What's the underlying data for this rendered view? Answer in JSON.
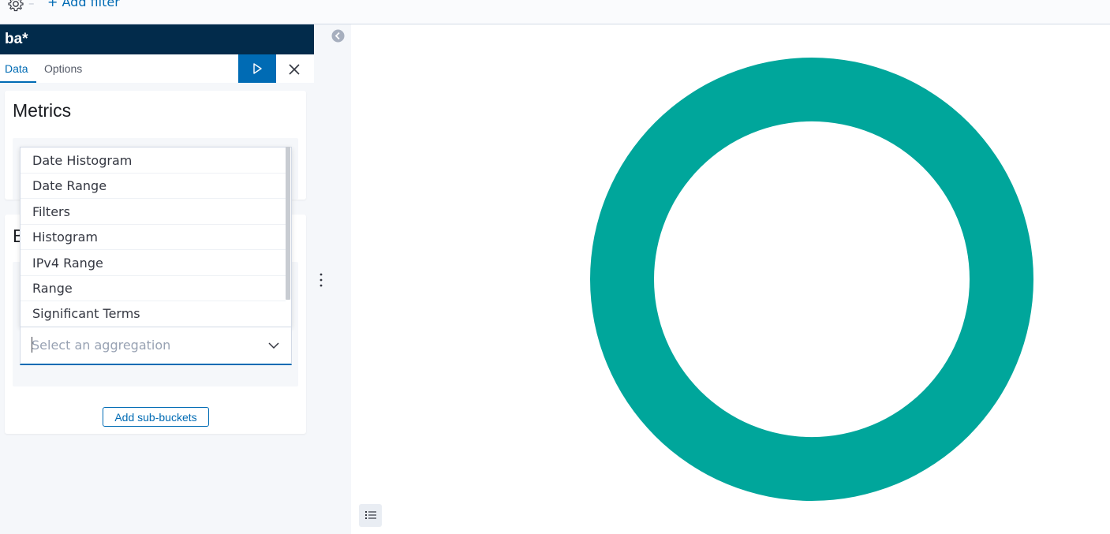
{
  "filter_bar": {
    "add_filter_label": "+ Add filter",
    "separator": "–"
  },
  "sidebar": {
    "index_pattern": "ba*",
    "tabs": [
      {
        "label": "Data",
        "active": true
      },
      {
        "label": "Options",
        "active": false
      }
    ],
    "metrics_title": "Metrics",
    "buckets_title_visible": "B",
    "add_sub_buckets_label": "Add sub-buckets"
  },
  "aggregation_dropdown": {
    "options": [
      "Date Histogram",
      "Date Range",
      "Filters",
      "Histogram",
      "IPv4 Range",
      "Range",
      "Significant Terms"
    ],
    "placeholder": "Select an aggregation"
  },
  "chart_data": {
    "type": "pie",
    "donut": true,
    "slices": [
      {
        "value": 100,
        "color": "#00a69b"
      }
    ]
  },
  "colors": {
    "accent": "#006bb4",
    "title_bar": "#022b4b",
    "donut": "#00a69b"
  }
}
